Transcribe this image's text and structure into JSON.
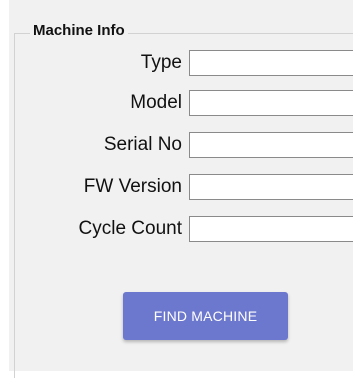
{
  "machine_info": {
    "title": "Machine Info",
    "fields": [
      {
        "label": "Type",
        "value": ""
      },
      {
        "label": "Model",
        "value": ""
      },
      {
        "label": "Serial No",
        "value": ""
      },
      {
        "label": "FW Version",
        "value": ""
      },
      {
        "label": "Cycle Count",
        "value": ""
      }
    ],
    "find_button_label": "FIND MACHINE"
  },
  "colors": {
    "panel_background": "#f1f1f1",
    "button_background": "#6c78cd",
    "button_text": "#ffffff",
    "field_border": "#8a8a8a"
  }
}
